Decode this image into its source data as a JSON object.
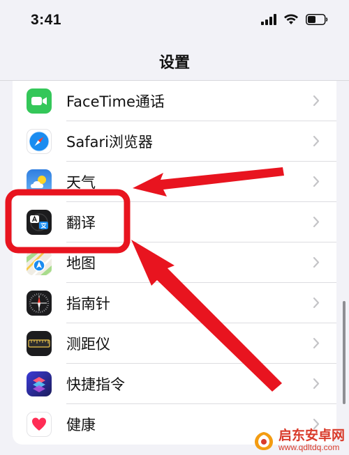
{
  "status_bar": {
    "time": "3:41"
  },
  "nav": {
    "title": "设置"
  },
  "rows": [
    {
      "label": "FaceTime通话",
      "icon": "facetime-icon"
    },
    {
      "label": "Safari浏览器",
      "icon": "safari-icon"
    },
    {
      "label": "天气",
      "icon": "weather-icon"
    },
    {
      "label": "翻译",
      "icon": "translate-icon"
    },
    {
      "label": "地图",
      "icon": "maps-icon"
    },
    {
      "label": "指南针",
      "icon": "compass-icon"
    },
    {
      "label": "测距仪",
      "icon": "measure-icon"
    },
    {
      "label": "快捷指令",
      "icon": "shortcuts-icon"
    },
    {
      "label": "健康",
      "icon": "health-icon"
    }
  ],
  "annotation": {
    "highlight_color": "#e8141f",
    "highlighted_item": "翻译"
  },
  "watermark": {
    "name": "启东安卓网",
    "url": "www.qdltdq.com"
  }
}
